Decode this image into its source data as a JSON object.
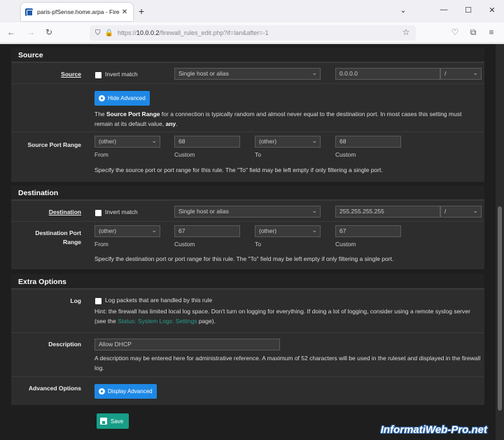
{
  "browser": {
    "tab_title": "paris-pfSense.home.arpa - Fire",
    "url_prefix": "https://",
    "url_host": "10.0.0.2",
    "url_path": "/firewall_rules_edit.php?if=lan&after=-1",
    "new_tab_label": "+"
  },
  "source": {
    "header": "Source",
    "label": "Source",
    "invert_label": "Invert match",
    "type_value": "Single host or alias",
    "address_value": "0.0.0.0",
    "mask_value": "/",
    "hide_advanced_label": "Hide Advanced",
    "port_note_pre": "The ",
    "port_note_bold": "Source Port Range",
    "port_note_mid": " for a connection is typically random and almost never equal to the destination port. In most cases this setting must remain at its default value, ",
    "port_note_any": "any",
    "port_note_end": ".",
    "port_range_label": "Source Port Range",
    "from_select": "(other)",
    "from_value": "68",
    "to_select": "(other)",
    "to_value": "68",
    "from_caption": "From",
    "custom_caption": "Custom",
    "to_caption": "To",
    "custom_caption_2": "Custom",
    "port_help": "Specify the source port or port range for this rule. The \"To\" field may be left empty if only filtering a single port."
  },
  "destination": {
    "header": "Destination",
    "label": "Destination",
    "invert_label": "Invert match",
    "type_value": "Single host or alias",
    "address_value": "255.255.255.255",
    "mask_value": "/",
    "port_range_label_1": "Destination Port",
    "port_range_label_2": "Range",
    "from_select": "(other)",
    "from_value": "67",
    "to_select": "(other)",
    "to_value": "67",
    "from_caption": "From",
    "custom_caption": "Custom",
    "to_caption": "To",
    "custom_caption_2": "Custom",
    "port_help": "Specify the destination port or port range for this rule. The \"To\" field may be left empty if only filtering a single port."
  },
  "extra": {
    "header": "Extra Options",
    "log_label": "Log",
    "log_checkbox_label": "Log packets that are handled by this rule",
    "log_hint_pre": "Hint: the firewall has limited local log space. Don't turn on logging for everything. If doing a lot of logging, consider using a remote syslog server (see the ",
    "log_hint_link": "Status: System Logs: Settings",
    "log_hint_post": " page).",
    "description_label": "Description",
    "description_value": "Allow DHCP",
    "description_help": "A description may be entered here for administrative reference. A maximum of 52 characters will be used in the ruleset and displayed in the firewall log.",
    "advanced_label": "Advanced Options",
    "display_advanced_label": "Display Advanced"
  },
  "save_label": "Save",
  "watermark": "InformatiWeb-Pro.net",
  "colors": {
    "accent_blue": "#1e88e5",
    "save_green": "#189d88",
    "link": "#2a9d8f"
  }
}
